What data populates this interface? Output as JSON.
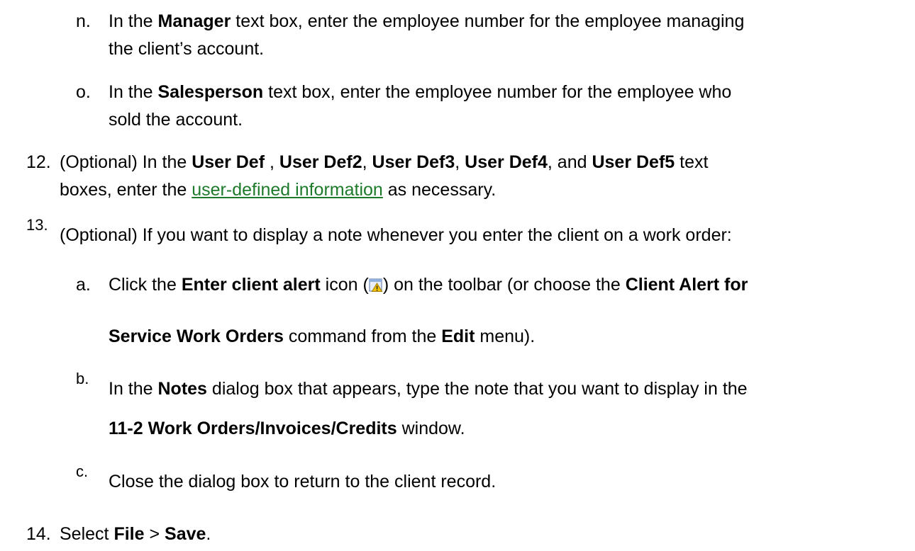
{
  "steps": {
    "n": {
      "marker": "n.",
      "t1": "In the ",
      "b1": "Manager",
      "t2": " text box, enter the employee number for the employee managing",
      "line2": "the client’s account."
    },
    "o": {
      "marker": "o.",
      "t1": "In the ",
      "b1": "Salesperson",
      "t2": " text box, enter the employee number for the employee who",
      "line2": "sold the account."
    },
    "s12": {
      "marker": "12.",
      "t1": "(Optional) In the ",
      "b1": "User Def",
      "t2": " , ",
      "b2": "User Def2",
      "t3": ", ",
      "b3": "User Def3",
      "t4": ", ",
      "b4": "User Def4",
      "t5": ", and ",
      "b5": "User Def5",
      "t6": " text",
      "line2_pre": "boxes, enter the ",
      "link": "user-defined information",
      "line2_post": " as necessary."
    },
    "s13": {
      "marker": "13.",
      "text": "(Optional) If you want to display a note whenever you enter the client on a work order:"
    },
    "a": {
      "marker": "a.",
      "t1": "Click the ",
      "b1": "Enter client alert",
      "t2": " icon (",
      "icon": "client-alert-icon",
      "t3": ") on the toolbar (or choose the ",
      "b2": "Client Alert for",
      "line2_b": "Service Work Orders",
      "line2_t": " command from the ",
      "line2_b2": "Edit",
      "line2_t2": " menu)."
    },
    "b": {
      "marker": "b.",
      "t1": "In the ",
      "b1": "Notes",
      "t2": " dialog box that appears, type the note that you want to display in the",
      "line2_b": "11-2 Work Orders/Invoices/Credits",
      "line2_t": " window."
    },
    "c": {
      "marker": "c.",
      "text": "Close the dialog box to return to the client record."
    },
    "s14": {
      "marker": "14.",
      "t1": "Select ",
      "b1": "File",
      "t2": " > ",
      "b2": "Save",
      "t3": "."
    }
  },
  "colors": {
    "link": "#1d7a2a",
    "text": "#000000"
  }
}
